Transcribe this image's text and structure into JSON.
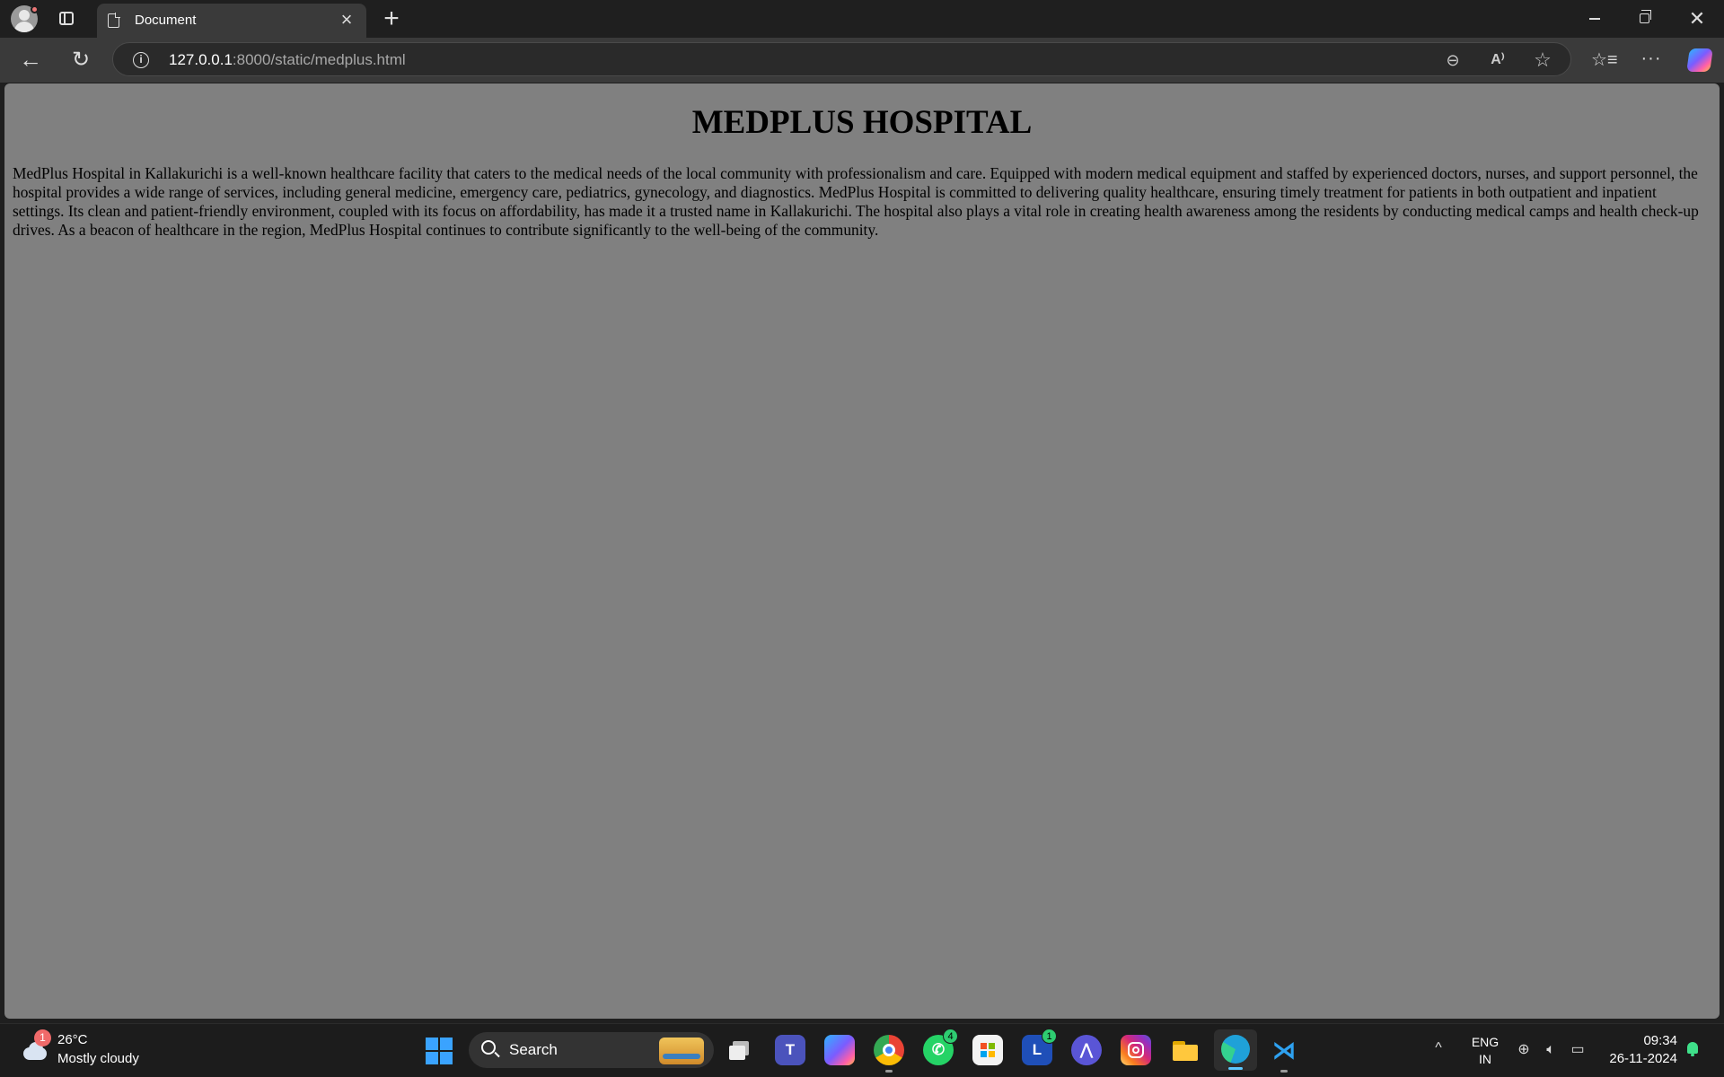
{
  "browser": {
    "tab_title": "Document",
    "url_host": "127.0.0.1",
    "url_rest": ":8000/static/medplus.html"
  },
  "page": {
    "heading": "MEDPLUS HOSPITAL",
    "paragraph": "MedPlus Hospital in Kallakurichi is a well-known healthcare facility that caters to the medical needs of the local community with professionalism and care. Equipped with modern medical equipment and staffed by experienced doctors, nurses, and support personnel, the hospital provides a wide range of services, including general medicine, emergency care, pediatrics, gynecology, and diagnostics. MedPlus Hospital is committed to delivering quality healthcare, ensuring timely treatment for patients in both outpatient and inpatient settings. Its clean and patient-friendly environment, coupled with its focus on affordability, has made it a trusted name in Kallakurichi. The hospital also plays a vital role in creating health awareness among the residents by conducting medical camps and health check-up drives. As a beacon of healthcare in the region, MedPlus Hospital continues to contribute significantly to the well-being of the community."
  },
  "taskbar": {
    "weather_badge": "1",
    "temperature": "26°C",
    "condition": "Mostly cloudy",
    "search_label": "Search",
    "whatsapp_badge": "4",
    "lapp_badge": "1",
    "lang_primary": "ENG",
    "lang_secondary": "IN",
    "time": "09:34",
    "date": "26-11-2024"
  },
  "colors": {
    "page_background": "#808080",
    "chrome_dark": "#1f1f1f",
    "toolbar": "#3a3a3a"
  }
}
